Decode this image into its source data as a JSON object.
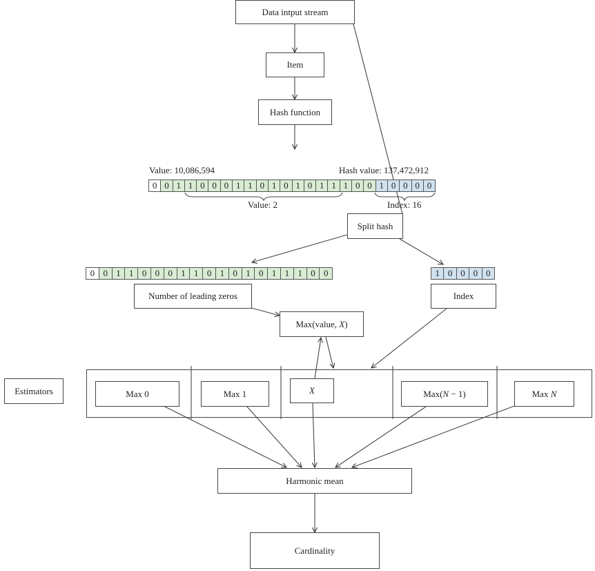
{
  "nodes": {
    "data_input_stream": "Data intput stream",
    "item": "Item",
    "hash_function": "Hash function",
    "split_hash": "Split hash",
    "leading_zeros": "Number of leading zeros",
    "index": "Index",
    "max_value_x": "Max(value, X)",
    "estimators": "Estimators",
    "max0": "Max 0",
    "max1": "Max 1",
    "x": "X",
    "max_n_minus_1": "Max(N − 1)",
    "max_n": "Max N",
    "harmonic_mean": "Harmonic mean",
    "cardinality": "Cardinality"
  },
  "hash_row": {
    "value_label": "Value: 10,086,594",
    "hash_value_label": "Hash value: 137,472,912",
    "brace_value_label": "Value: 2",
    "brace_index_label": "Index: 16",
    "sign_bit": [
      "0"
    ],
    "value_bits": [
      "0",
      "1",
      "1",
      "0",
      "0",
      "0",
      "1",
      "1",
      "0",
      "1",
      "0",
      "1",
      "0",
      "1",
      "1",
      "1",
      "0",
      "0"
    ],
    "index_bits": [
      "1",
      "0",
      "0",
      "0",
      "0"
    ]
  },
  "colors": {
    "value_bits_fill": "#d9ecd4",
    "index_bits_fill": "#d0e1ef",
    "sign_bit_fill": "#ffffff"
  }
}
